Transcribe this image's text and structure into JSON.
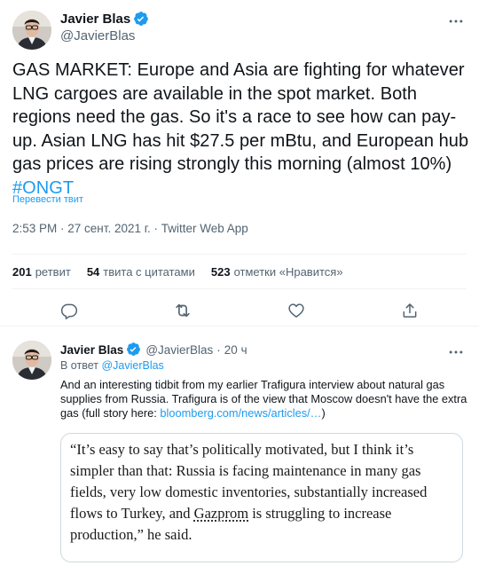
{
  "main_tweet": {
    "author": {
      "name": "Javier Blas",
      "handle": "@JavierBlas"
    },
    "text_before_hashtag": "GAS MARKET: Europe and Asia are fighting for whatever LNG cargoes are available in the spot market. Both regions need the gas. So it's a race to see how can pay-up. Asian LNG has hit $27.5 per mBtu, and European hub gas prices are rising strongly this morning (almost 10%) ",
    "hashtag": "#ONGT",
    "translate_label": "Перевести твит",
    "meta": "2:53 PM · 27 сент. 2021 г. · Twitter Web App",
    "stats": [
      {
        "count": "201",
        "label": "ретвит"
      },
      {
        "count": "54",
        "label": "твита с цитатами"
      },
      {
        "count": "523",
        "label": "отметки «Нравится»"
      }
    ],
    "actions": [
      "reply-icon",
      "retweet-icon",
      "like-icon",
      "share-icon"
    ]
  },
  "reply_tweet": {
    "author": {
      "name": "Javier Blas",
      "handle": "@JavierBlas"
    },
    "time": "20 ч",
    "reply_prefix": "В ответ ",
    "reply_to": "@JavierBlas",
    "text": "And an interesting tidbit from my earlier Trafigura interview about natural gas supplies from Russia. Trafigura is of the view that Moscow doesn't have the extra gas (full story here: ",
    "link": "bloomberg.com/news/articles/…",
    "text_after_link": ")",
    "quote_before": "“It’s easy to say that’s politically motivated, but I think it’s simpler than that: Russia is facing maintenance in many gas fields, very low domestic inventories, substantially increased flows to Turkey, and ",
    "quote_underlined": "Gazprom",
    "quote_after": " is struggling to increase production,” he said."
  },
  "colors": {
    "accent": "#1d9bf0",
    "text": "#0f1419",
    "secondary": "#536471",
    "border": "#eff3f4"
  }
}
